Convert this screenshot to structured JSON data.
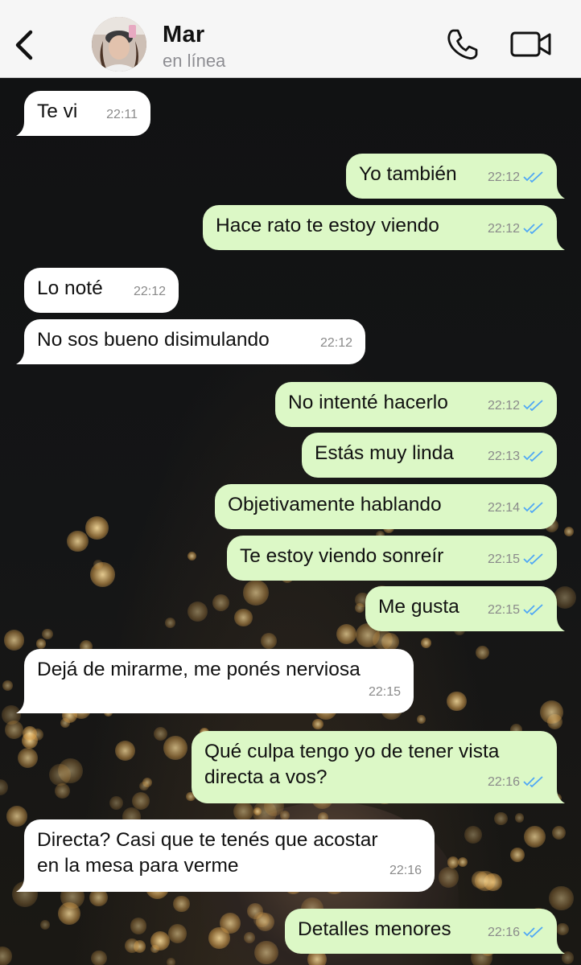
{
  "header": {
    "contact_name": "Mar",
    "status": "en línea"
  },
  "icons": {
    "back": "chevron-left-icon",
    "call": "phone-icon",
    "video": "video-camera-icon",
    "read_receipt": "double-check-icon"
  },
  "colors": {
    "outgoing_bubble": "#dcf8c6",
    "incoming_bubble": "#ffffff",
    "read_check": "#4fa7f5",
    "header_bg": "#f6f6f6"
  },
  "messages": [
    {
      "dir": "in",
      "text": "Te vi",
      "time": "22:11"
    },
    {
      "dir": "out",
      "text": "Yo también",
      "time": "22:12"
    },
    {
      "dir": "out",
      "text": "Hace rato te estoy viendo",
      "time": "22:12"
    },
    {
      "dir": "in",
      "text": "Lo noté",
      "time": "22:12"
    },
    {
      "dir": "in",
      "text": "No sos bueno disimulando",
      "time": "22:12"
    },
    {
      "dir": "out",
      "text": "No intenté hacerlo",
      "time": "22:12"
    },
    {
      "dir": "out",
      "text": "Estás muy linda",
      "time": "22:13"
    },
    {
      "dir": "out",
      "text": "Objetivamente hablando",
      "time": "22:14"
    },
    {
      "dir": "out",
      "text": "Te estoy viendo sonreír",
      "time": "22:15"
    },
    {
      "dir": "out",
      "text": "Me gusta",
      "time": "22:15"
    },
    {
      "dir": "in",
      "text": "Dejá de mirarme, me ponés nerviosa",
      "time": "22:15"
    },
    {
      "dir": "out",
      "text": "Qué culpa tengo yo de tener vista\ndirecta a vos?",
      "time": "22:16"
    },
    {
      "dir": "in",
      "text": "Directa? Casi que te tenés que acostar\nen la mesa para verme",
      "time": "22:16"
    },
    {
      "dir": "out",
      "text": "Detalles menores",
      "time": "22:16"
    }
  ]
}
